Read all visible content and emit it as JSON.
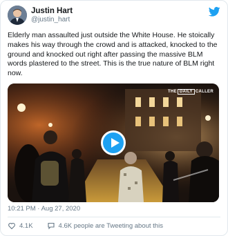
{
  "author": {
    "display_name": "Justin Hart",
    "handle": "@justin_hart"
  },
  "tweet": {
    "text": "Elderly man assaulted just outside the White House. He stoically makes his way through the crowd and is attacked, knocked to the ground and knocked out right after passing the massive BLM words plastered to the street. This is the true nature of BLM right now.",
    "timestamp": "10:21 PM · Aug 27, 2020"
  },
  "media": {
    "type": "video",
    "watermark_pre": "THE",
    "watermark_boxed": "DAILY",
    "watermark_post": "CALLER",
    "play_icon": "play-icon"
  },
  "actions": {
    "likes": "4.1K",
    "talking": "4.6K people are Tweeting about this"
  },
  "colors": {
    "brand": "#1da1f2",
    "text": "#14171a",
    "muted": "#657786",
    "border": "#e1e8ed"
  },
  "icons": {
    "logo": "twitter-bird-icon",
    "like": "heart-icon",
    "talking": "speech-bubble-icon"
  }
}
